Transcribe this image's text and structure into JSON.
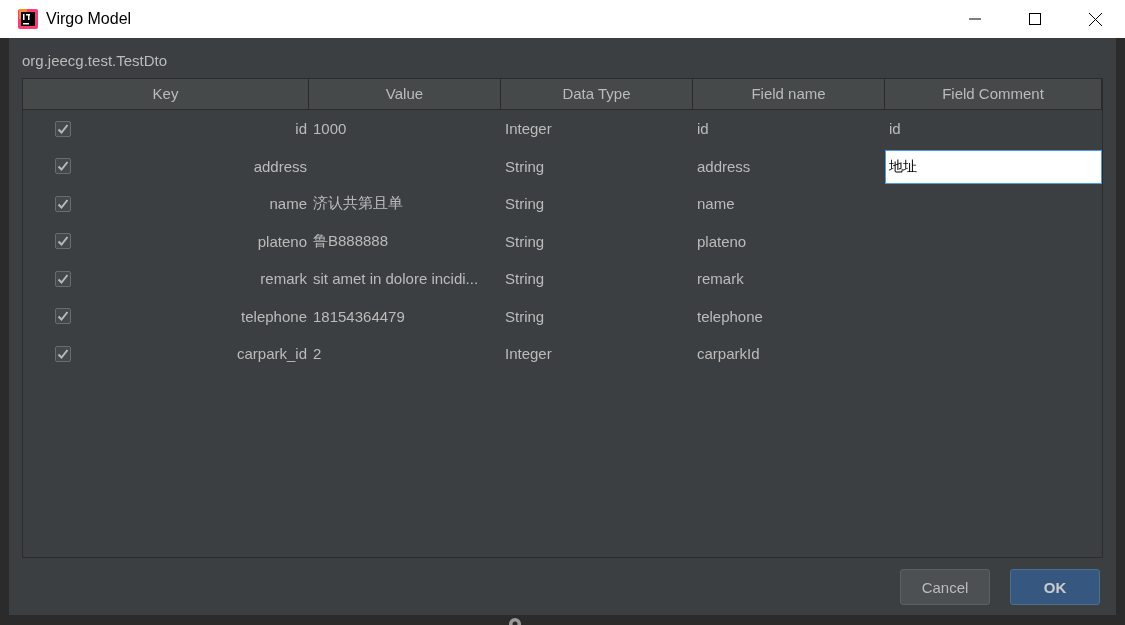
{
  "window": {
    "title": "Virgo Model"
  },
  "class_name": "org.jeecg.test.TestDto",
  "table": {
    "columns": [
      "Key",
      "Value",
      "Data Type",
      "Field name",
      "Field Comment"
    ],
    "rows": [
      {
        "checked": true,
        "key": "id",
        "value": "1000",
        "data_type": "Integer",
        "field_name": "id",
        "field_comment": {
          "text": "id",
          "editing": false
        }
      },
      {
        "checked": true,
        "key": "address",
        "data_type": "String",
        "field_name": "address",
        "field_comment": {
          "text": "地址",
          "editing": true
        }
      },
      {
        "checked": true,
        "key": "name",
        "value": "济认共第且单",
        "data_type": "String",
        "field_name": "name"
      },
      {
        "checked": true,
        "key": "plateno",
        "value": "鲁B888888",
        "data_type": "String",
        "field_name": "plateno"
      },
      {
        "checked": true,
        "key": "remark",
        "value": "sit amet in dolore incidi...",
        "data_type": "String",
        "field_name": "remark"
      },
      {
        "checked": true,
        "key": "telephone",
        "value": "18154364479",
        "data_type": "String",
        "field_name": "telephone"
      },
      {
        "checked": true,
        "key": "carpark_id",
        "value": "2",
        "data_type": "Integer",
        "field_name": "carparkId"
      }
    ]
  },
  "buttons": [
    {
      "label": "Cancel",
      "kind": "secondary"
    },
    {
      "label": "OK",
      "kind": "primary"
    }
  ]
}
